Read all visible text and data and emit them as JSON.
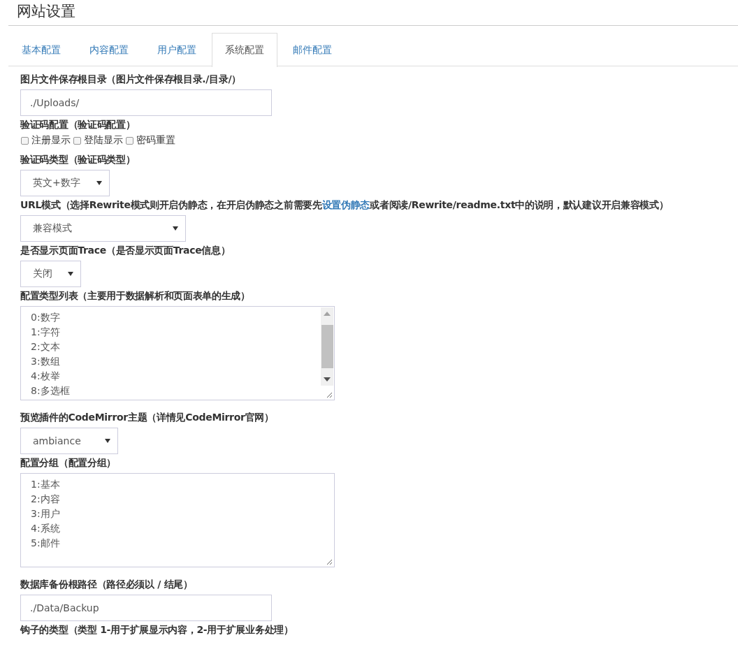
{
  "page_title": "网站设置",
  "tabs": [
    {
      "label": "基本配置",
      "selected": false
    },
    {
      "label": "内容配置",
      "selected": false
    },
    {
      "label": "用户配置",
      "selected": false
    },
    {
      "label": "系统配置",
      "selected": true
    },
    {
      "label": "邮件配置",
      "selected": false
    }
  ],
  "fields": [
    {
      "kind": "text",
      "label": "图片文件保存根目录（图片文件保存根目录./目录/）",
      "value": "./Uploads/"
    },
    {
      "kind": "checkboxes",
      "label": "验证码配置（验证码配置）",
      "options": [
        {
          "label": "注册显示",
          "checked": false
        },
        {
          "label": "登陆显示",
          "checked": false
        },
        {
          "label": "密码重置",
          "checked": false
        }
      ]
    },
    {
      "kind": "select",
      "label": "验证码类型（验证码类型）",
      "value": "英文+数字"
    },
    {
      "kind": "select",
      "label": "URL模式（选择Rewrite模式则开启伪静态，在开启伪静态之前需要先",
      "link": "设置伪静态",
      "label_after": "或者阅读/Rewrite/readme.txt中的说明，默认建议开启兼容模式）",
      "value": "兼容模式"
    },
    {
      "kind": "select",
      "label": "是否显示页面Trace（是否显示页面Trace信息）",
      "value": "关闭"
    },
    {
      "kind": "textarea",
      "label": "配置类型列表（主要用于数据解析和页面表单的生成）",
      "scrollbar": true,
      "lines": [
        "0:数字",
        "1:字符",
        "2:文本",
        "3:数组",
        "4:枚举",
        "8:多选框"
      ]
    },
    {
      "kind": "select",
      "label": "预览插件的CodeMirror主题（详情见CodeMirror官网）",
      "value": "ambiance"
    },
    {
      "kind": "textarea",
      "label": "配置分组（配置分组）",
      "scrollbar": false,
      "lines": [
        "1:基本",
        "2:内容",
        "3:用户",
        "4:系统",
        "5:邮件"
      ]
    },
    {
      "kind": "text",
      "label": "数据库备份根路径（路径必须以 / 结尾）",
      "value": "./Data/Backup"
    },
    {
      "kind": "label",
      "label": "钩子的类型（类型 1-用于扩展显示内容，2-用于扩展业务处理）"
    }
  ]
}
